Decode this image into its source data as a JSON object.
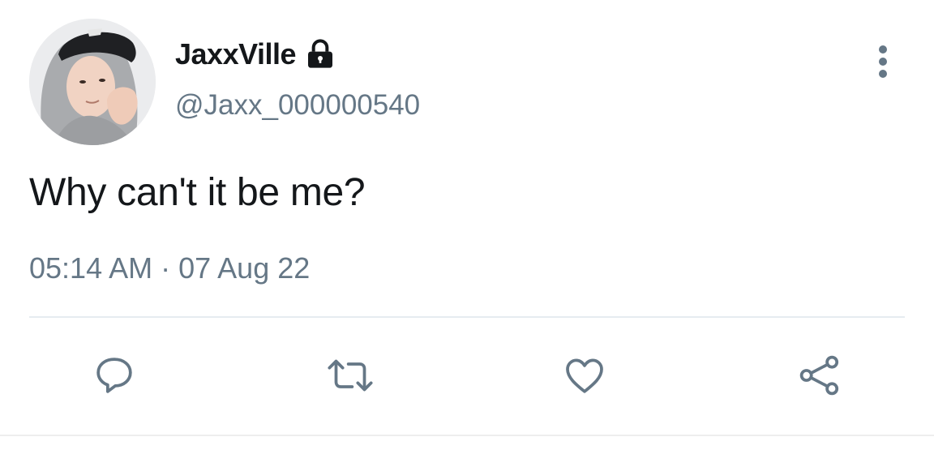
{
  "tweet": {
    "display_name": "JaxxVille",
    "handle": "@Jaxx_000000540",
    "text": "Why can't it be me?",
    "time": "05:14 AM",
    "separator": "·",
    "date": "07 Aug 22"
  },
  "icons": {
    "protected": "lock-icon",
    "more": "more-vertical-icon",
    "reply": "reply-icon",
    "retweet": "retweet-icon",
    "like": "heart-icon",
    "share": "share-icon"
  },
  "colors": {
    "text_primary": "#14171a",
    "text_secondary": "#657786",
    "divider": "#e6ecf0"
  }
}
